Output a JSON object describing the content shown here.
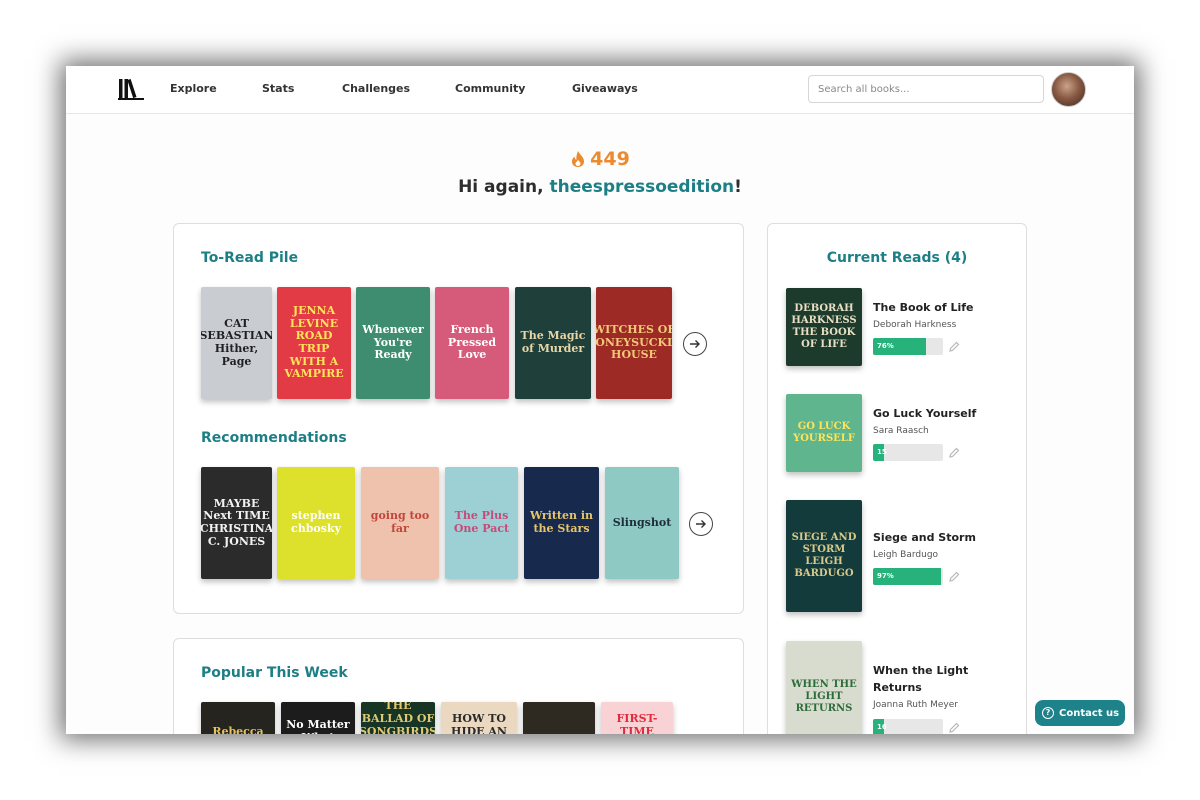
{
  "nav": {
    "items": [
      "Explore",
      "Stats",
      "Challenges",
      "Community",
      "Giveaways"
    ],
    "search_placeholder": "Search all books..."
  },
  "greeting": {
    "streak": "449",
    "prefix": "Hi again, ",
    "username": "theespressoedition",
    "suffix": "!"
  },
  "to_read": {
    "title": "To-Read Pile",
    "books": [
      {
        "cover_text": "CAT SEBASTIAN Hither, Page",
        "bg": "#c9ccd0",
        "fg": "#1f1f24"
      },
      {
        "cover_text": "JENNA LEVINE ROAD TRIP WITH A VAMPIRE",
        "bg": "#e23b45",
        "fg": "#ffe45a"
      },
      {
        "cover_text": "Whenever You're Ready",
        "bg": "#3f8d70",
        "fg": "#ffffff"
      },
      {
        "cover_text": "French Pressed Love",
        "bg": "#d65b7b",
        "fg": "#ffffff"
      },
      {
        "cover_text": "The Magic of Murder",
        "bg": "#1f3f3a",
        "fg": "#e7d7a8"
      },
      {
        "cover_text": "WITCHES OF HONEYSUCKLE HOUSE",
        "bg": "#9d2a24",
        "fg": "#f0c978"
      }
    ]
  },
  "recommendations": {
    "title": "Recommendations",
    "books": [
      {
        "cover_text": "MAYBE Next TIME CHRISTINA C. JONES",
        "bg": "#2b2b2b",
        "fg": "#f2f2f2"
      },
      {
        "cover_text": "stephen chbosky",
        "bg": "#dde12c",
        "fg": "#ffffff"
      },
      {
        "cover_text": "going too far",
        "bg": "#efc2ad",
        "fg": "#c2463c"
      },
      {
        "cover_text": "The Plus One Pact",
        "bg": "#9cd0d4",
        "fg": "#c54c7a"
      },
      {
        "cover_text": "Written in the Stars",
        "bg": "#17294d",
        "fg": "#e8c56a"
      },
      {
        "cover_text": "Slingshot",
        "bg": "#8fc9c4",
        "fg": "#1e2d3a"
      }
    ]
  },
  "popular": {
    "title": "Popular This Week",
    "books": [
      {
        "cover_text": "Rebecca",
        "bg": "#26241f",
        "fg": "#e6c35a"
      },
      {
        "cover_text": "No Matter What",
        "bg": "#1c1c1c",
        "fg": "#ffffff"
      },
      {
        "cover_text": "THE BALLAD OF SONGBIRDS AND SNAKES",
        "bg": "#163524",
        "fg": "#e1c873"
      },
      {
        "cover_text": "HOW TO HIDE AN EMPIRE",
        "bg": "#ead8c0",
        "fg": "#2a2a2a"
      },
      {
        "cover_text": "",
        "bg": "#2e2a22",
        "fg": "#ffffff"
      },
      {
        "cover_text": "FIRST-TIME CALLER",
        "bg": "#f9d2d5",
        "fg": "#e12a3b"
      }
    ]
  },
  "current_reads": {
    "title": "Current Reads (4)",
    "books": [
      {
        "title": "The Book of Life",
        "author": "Deborah Harkness",
        "progress": 76,
        "label": "76%",
        "cover_text": "DEBORAH HARKNESS THE BOOK OF LIFE",
        "bg": "#1d3b2c",
        "fg": "#e8dfc4"
      },
      {
        "title": "Go Luck Yourself",
        "author": "Sara Raasch",
        "progress": 15,
        "label": "15",
        "cover_text": "GO LUCK YOURSELF",
        "bg": "#5fb58d",
        "fg": "#ffe45a"
      },
      {
        "title": "Siege and Storm",
        "author": "Leigh Bardugo",
        "progress": 97,
        "label": "97%",
        "cover_text": "SIEGE AND STORM LEIGH BARDUGO",
        "bg": "#143b3b",
        "fg": "#d9c98a"
      },
      {
        "title": "When the Light Returns",
        "author": "Joanna Ruth Meyer",
        "progress": 16,
        "label": "16",
        "cover_text": "WHEN THE LIGHT RETURNS",
        "bg": "#d8dccf",
        "fg": "#2e6b3a"
      }
    ]
  },
  "contact": {
    "label": "Contact us"
  },
  "colors": {
    "accent": "#1d7f86",
    "streak": "#ec8a2f",
    "progress": "#26b27a"
  }
}
